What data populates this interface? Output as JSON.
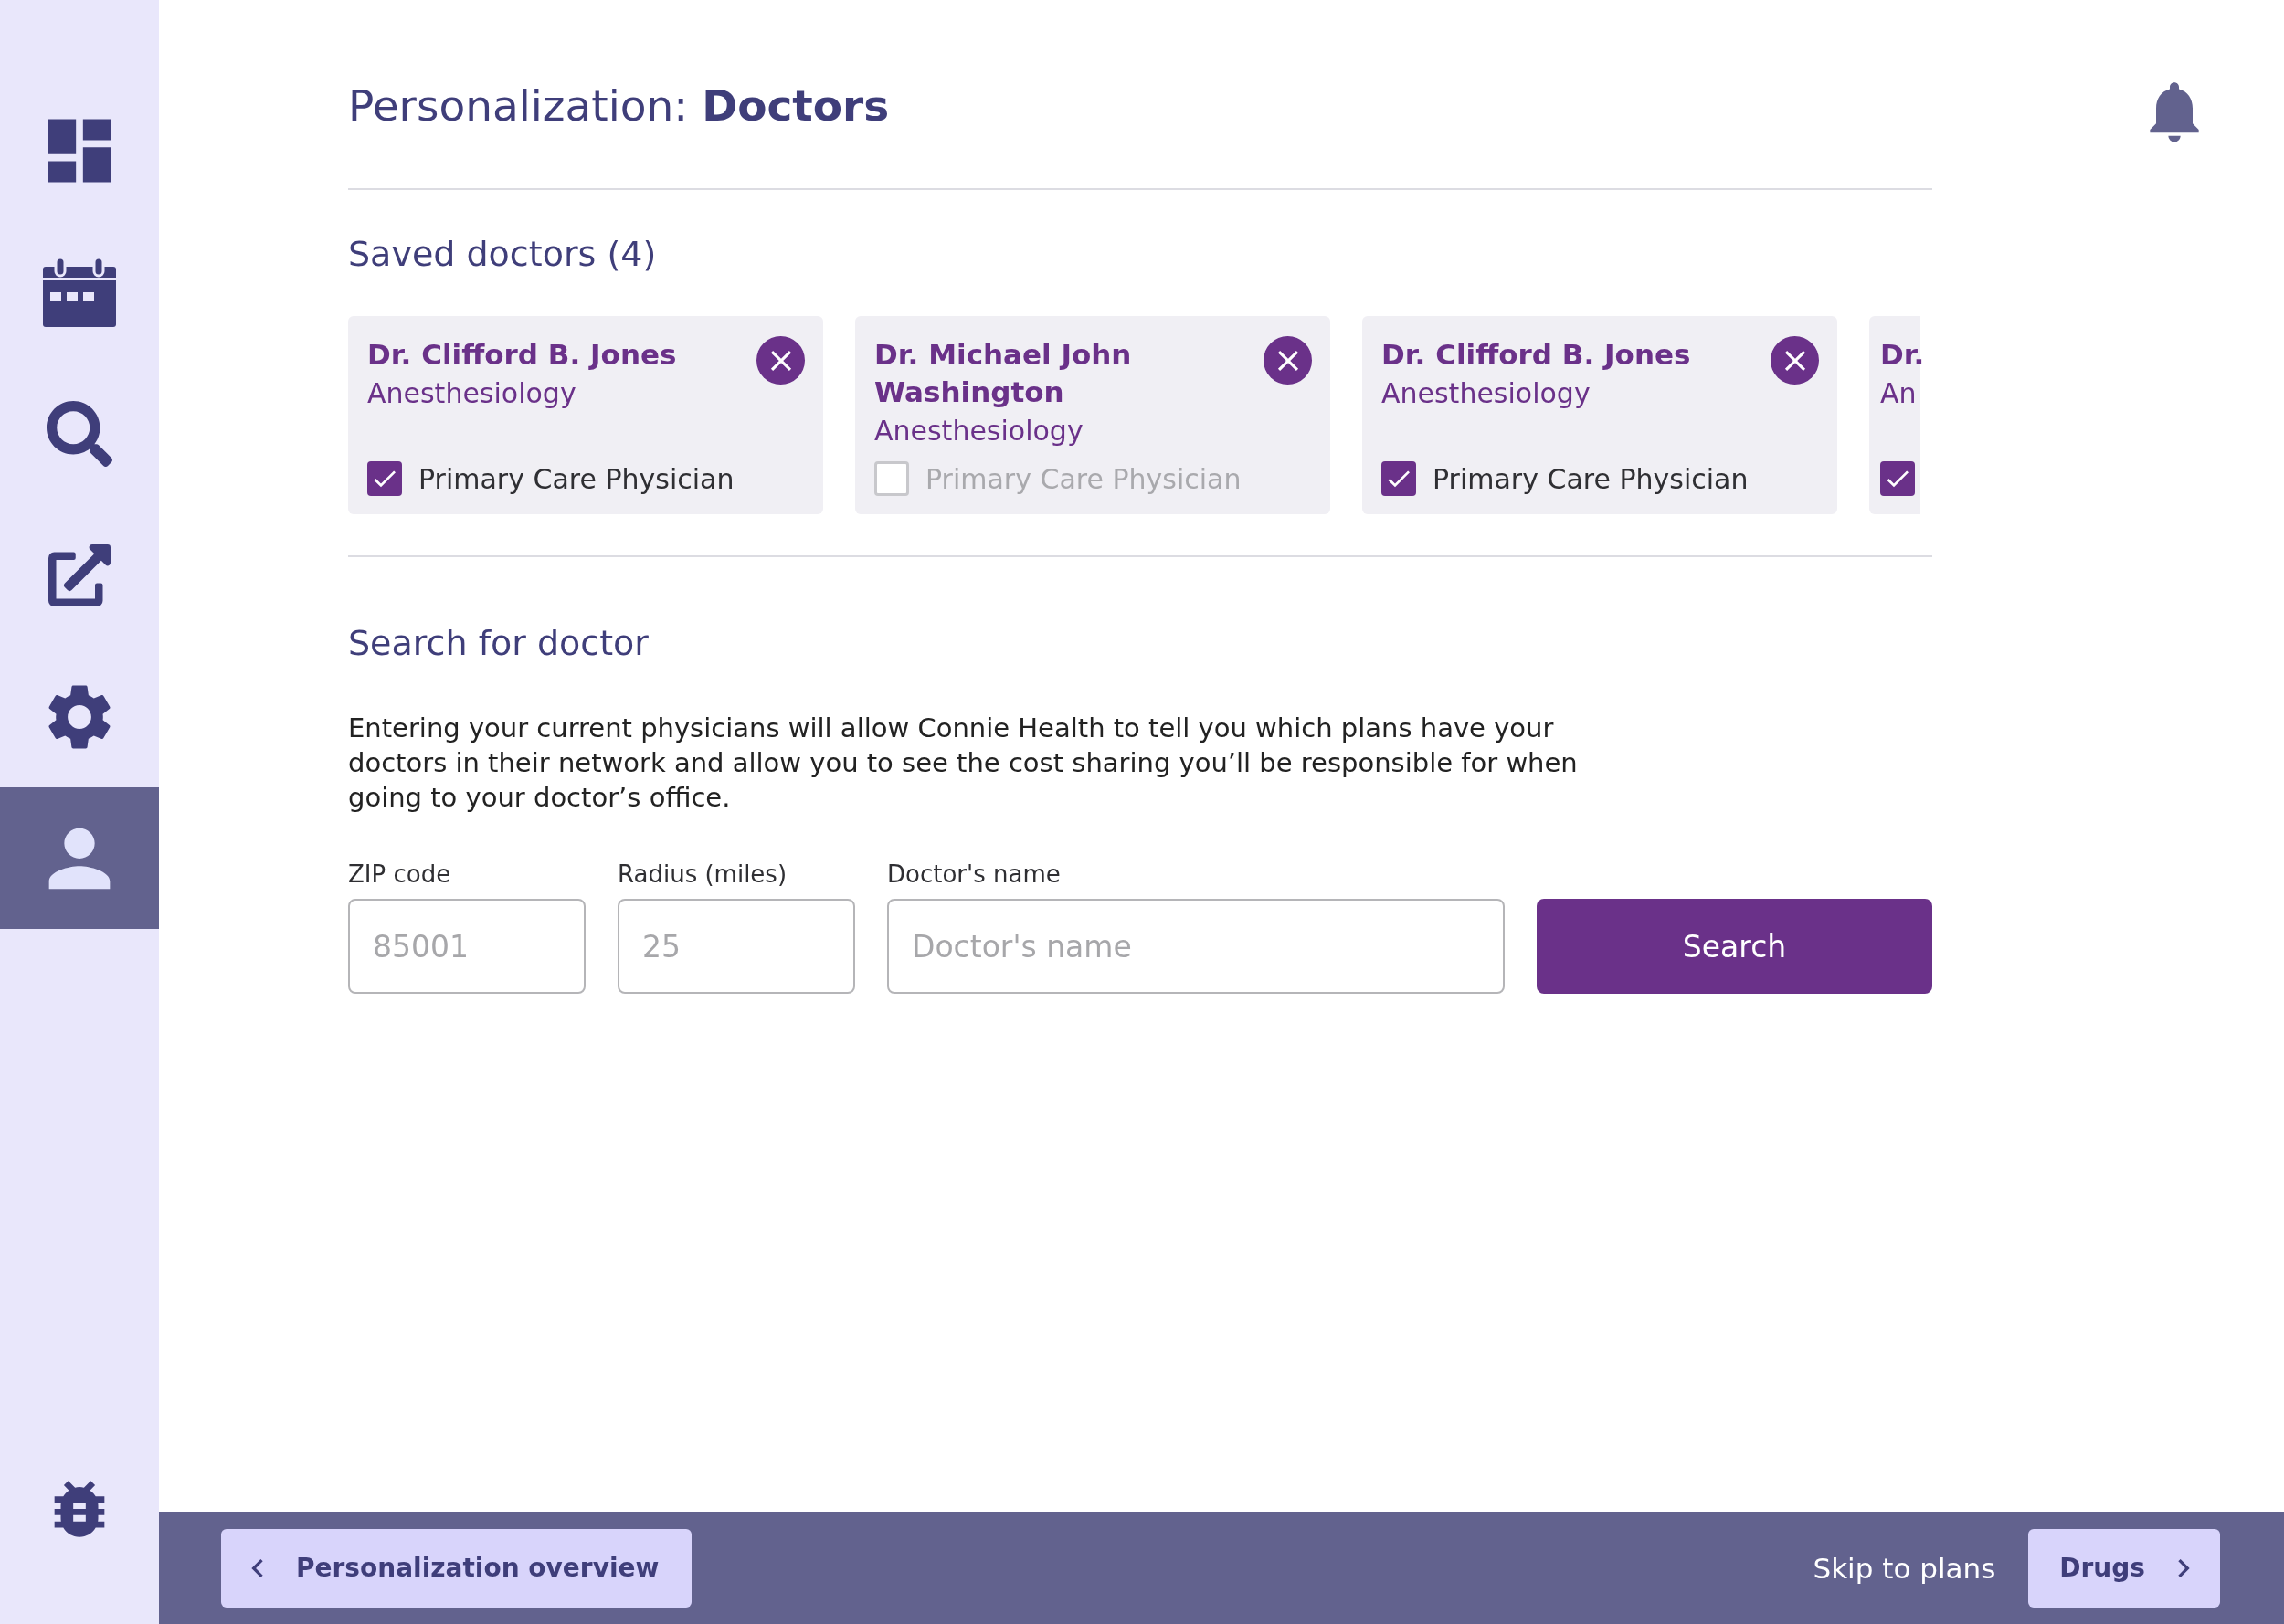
{
  "sidebar": {
    "items": [
      {
        "selected": false
      },
      {
        "selected": false
      },
      {
        "selected": false
      },
      {
        "selected": false
      },
      {
        "selected": false
      },
      {
        "selected": true
      }
    ]
  },
  "header": {
    "title_prefix": "Personalization:",
    "title_main": "Doctors"
  },
  "saved": {
    "heading": "Saved doctors (4)",
    "cards": [
      {
        "kind": "full",
        "name": "Dr. Clifford B. Jones",
        "specialty": "Anesthesiology",
        "pcp_label": "Primary Care Physician",
        "checked": true
      },
      {
        "kind": "full",
        "name": "Dr. Michael John Washington",
        "specialty": "Anesthesiology",
        "pcp_label": "Primary Care Physician",
        "checked": false
      },
      {
        "kind": "full",
        "name": "Dr. Clifford B. Jones",
        "specialty": "Anesthesiology",
        "pcp_label": "Primary Care Physician",
        "checked": true
      },
      {
        "kind": "partial",
        "name": "Dr.",
        "specialty": "An",
        "checked": true
      }
    ]
  },
  "search": {
    "heading": "Search for doctor",
    "description": "Entering your current physicians will allow Connie Health to tell you which plans have your doctors in their network and allow you to see the cost sharing you’ll be responsible for when going to your doctor’s office.",
    "fields": [
      {
        "label": "ZIP code",
        "placeholder": "85001"
      },
      {
        "label": "Radius (miles)",
        "placeholder": "25"
      },
      {
        "label": "Doctor's name",
        "placeholder": "Doctor's name"
      }
    ],
    "button": "Search"
  },
  "footer": {
    "back": "Personalization overview",
    "skip": "Skip to plans",
    "next": "Drugs"
  }
}
